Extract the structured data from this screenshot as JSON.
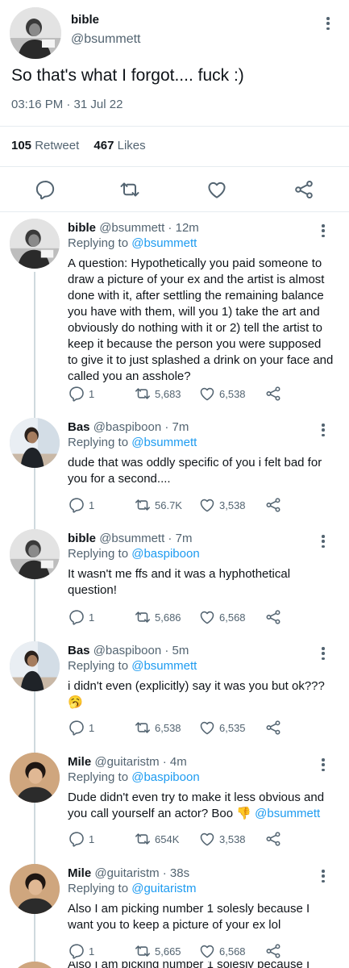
{
  "main_tweet": {
    "name": "bible",
    "handle": "@bsummett",
    "text": "So that's what I forgot.... fuck :)",
    "timestamp": "03:16 PM · 31 Jul 22",
    "retweets_count": "105",
    "retweets_label": "Retweet",
    "likes_count": "467",
    "likes_label": "Likes"
  },
  "replies": [
    {
      "name": "bible",
      "handle": "@bsummett · 12m",
      "replying_label": "Replying to",
      "replying_to": "@bsummett",
      "text": "A question: Hypothetically you paid someone to draw a picture of your ex and the artist is almost done with it, after settling the remaining balance you have with them, will you 1) take the art and obviously do nothing with it or 2) tell the artist to keep it because the person you were supposed to give it to just splashed a drink on your face and called you an asshole?",
      "replies": "1",
      "retweets": "5,683",
      "likes": "6,538"
    },
    {
      "name": "Bas",
      "handle": "@baspiboon · 7m",
      "replying_label": "Replying to",
      "replying_to": "@bsummett",
      "text": "dude that was oddly specific of you i felt bad for you for a second....",
      "replies": "1",
      "retweets": "56.7K",
      "likes": "3,538"
    },
    {
      "name": "bible",
      "handle": "@bsummett · 7m",
      "replying_label": "Replying to",
      "replying_to": "@baspiboon",
      "text": "It wasn't me ffs and it was a hyphothetical question!",
      "replies": "1",
      "retweets": "5,686",
      "likes": "6,568"
    },
    {
      "name": "Bas",
      "handle": "@baspiboon · 5m",
      "replying_label": "Replying to",
      "replying_to": "@bsummett",
      "text": "i didn't even (explicitly) say it was you but ok???",
      "emoji": "🥱",
      "replies": "1",
      "retweets": "6,538",
      "likes": "6,535"
    },
    {
      "name": "Mile",
      "handle": "@guitaristm · 4m",
      "replying_label": "Replying to",
      "replying_to": "@baspiboon",
      "text": "Dude didn't even try to make it less obvious and you call yourself an actor? Boo 👎",
      "mention": "@bsummett",
      "replies": "1",
      "retweets": "654K",
      "likes": "3,538"
    },
    {
      "name": "Mile",
      "handle": "@guitaristm · 38s",
      "replying_label": "Replying to",
      "replying_to": "@guitaristm",
      "text": "Also I am picking number 1 solesly because I want you to keep a picture of your ex lol",
      "replies": "1",
      "retweets": "5,665",
      "likes": "6,568"
    }
  ],
  "partial_bottom_text": "Also I am picking number 1 solesly because I",
  "colors": {
    "link": "#1d9bf0",
    "secondary_text": "#536471",
    "primary_text": "#0f1419",
    "divider": "#e6ecf0",
    "icon": "#536471"
  },
  "icons": [
    "more-vert-icon",
    "reply-icon",
    "retweet-icon",
    "like-icon",
    "share-icon"
  ]
}
